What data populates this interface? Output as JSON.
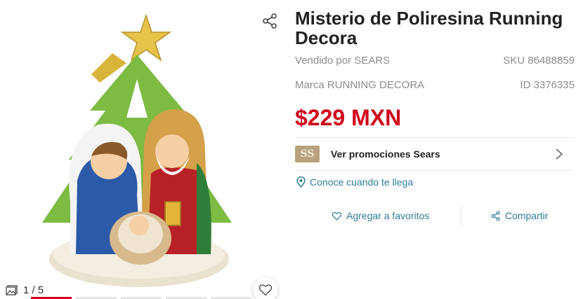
{
  "gallery": {
    "image_alt": "Misterio de Poliresina Running Decora",
    "counter": "1 / 5",
    "share_icon": "share-icon",
    "favorite_icon": "heart-icon",
    "accent": "#d0021b"
  },
  "product": {
    "title": "Misterio de Poliresina Running Decora",
    "sold_by": "Vendido por SEARS",
    "sku": "SKU 86488859",
    "brand": "Marca RUNNING DECORA",
    "id": "ID 3376335",
    "price": "$229 MXN",
    "price_color": "#d0021b"
  },
  "promo": {
    "label": "Ver promociones Sears",
    "logo_text": "SS"
  },
  "delivery": {
    "label": "Conoce cuando te llega",
    "color": "#2c7e97"
  },
  "actions": {
    "favorite_label": "Agregar a favoritos",
    "share_label": "Compartir"
  }
}
